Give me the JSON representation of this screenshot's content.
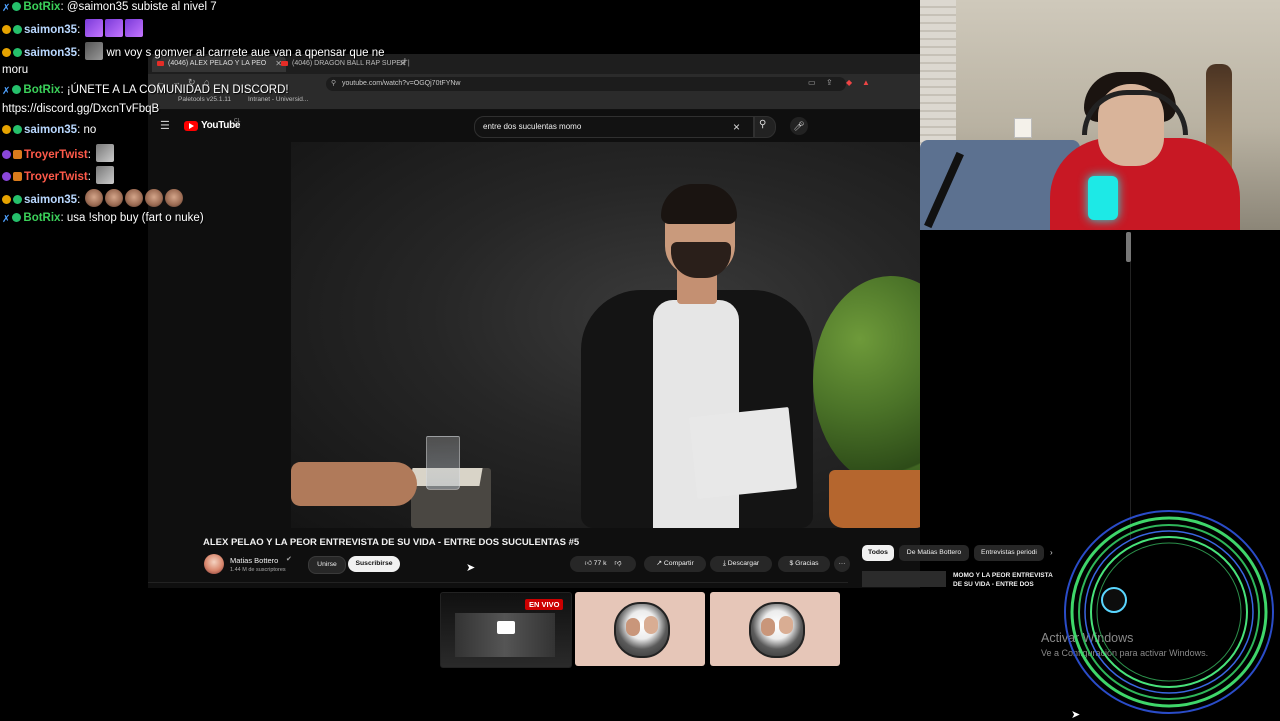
{
  "chat": [
    {
      "badges": [
        "bot",
        "green"
      ],
      "user": "BotRix",
      "type": "bot",
      "text": "@saimon35 subiste al nivel 7",
      "emotes": []
    },
    {
      "badges": [
        "gold",
        "green"
      ],
      "user": "saimon35",
      "type": "saimon",
      "text": "",
      "emotes": [
        "purple",
        "purple",
        "purple"
      ]
    },
    {
      "badges": [
        "gold",
        "green"
      ],
      "user": "saimon35",
      "type": "saimon",
      "text": "wn voy s gomver al carrrete aue van a qpensar que ne",
      "emotes": [
        "gray"
      ]
    },
    {
      "badges": [],
      "user": "",
      "type": "plain",
      "text": "moru",
      "emotes": []
    },
    {
      "badges": [
        "bot",
        "green"
      ],
      "user": "BotRix",
      "type": "bot",
      "text": "¡ÚNETE A LA COMUNIDAD EN DISCORD!",
      "emotes": []
    },
    {
      "badges": [],
      "user": "",
      "type": "plain",
      "text": "https://discord.gg/DxcnTvFbqB",
      "emotes": []
    },
    {
      "badges": [
        "gold",
        "green"
      ],
      "user": "saimon35",
      "type": "saimon",
      "text": "no",
      "emotes": []
    },
    {
      "badges": [
        "purple",
        "orange"
      ],
      "user": "TroyerTwist",
      "type": "troyer",
      "text": "",
      "emotes": [
        "pale"
      ]
    },
    {
      "badges": [
        "purple",
        "orange"
      ],
      "user": "TroyerTwist",
      "type": "troyer",
      "text": "",
      "emotes": [
        "pale"
      ]
    },
    {
      "badges": [
        "gold",
        "green"
      ],
      "user": "saimon35",
      "type": "saimon",
      "text": "",
      "emotes": [
        "face",
        "face",
        "face",
        "face",
        "face"
      ]
    },
    {
      "badges": [
        "bot",
        "green"
      ],
      "user": "BotRix",
      "type": "bot",
      "text": "usa !shop buy (fart o nuke)",
      "emotes": []
    }
  ],
  "browser": {
    "tabs": [
      {
        "label": "(4046) ALEX PELAO Y LA PEO",
        "active": true
      },
      {
        "label": "(4046) DRAGON BALL RAP SUPER |",
        "active": false
      }
    ],
    "new_tab": "+",
    "url": "youtube.com/watch?v=OGQj70tFYNw",
    "bookmarks": [
      "Paletools v25.1.11",
      "Intranet - Universid..."
    ]
  },
  "youtube": {
    "logo": "YouTube",
    "country": "CL",
    "search_value": "entre dos suculentas momo",
    "video_title": "ALEX PELAO Y LA PEOR ENTREVISTA DE SU VIDA - ENTRE DOS SUCULENTAS #5",
    "channel": "Matias Bottero",
    "subscribers": "1.44 M de suscriptores",
    "join": "Unirse",
    "subscribe": "Suscribirse",
    "likes": "77 k",
    "share": "Compartir",
    "download": "Descargar",
    "thanks": "Gracias",
    "more": "···",
    "chips": [
      "Todos",
      "De Matias Bottero",
      "Entrevistas periodi"
    ],
    "rec_title": "MOMO Y LA PEOR ENTREVISTA DE SU VIDA - ENTRE DOS"
  },
  "thumbnails": {
    "live_badge": "EN VIVO"
  },
  "windows": {
    "activate_title": "Activar Windows",
    "activate_sub": "Ve a Configuración para activar Windows."
  },
  "colors": {
    "yt_red": "#ff0000",
    "bot_name": "#3bd15a",
    "saimon_name": "#b9d8ff",
    "troyer_name": "#ff5a4a",
    "hoodie": "#c81824",
    "ring": "#3ad15a"
  }
}
